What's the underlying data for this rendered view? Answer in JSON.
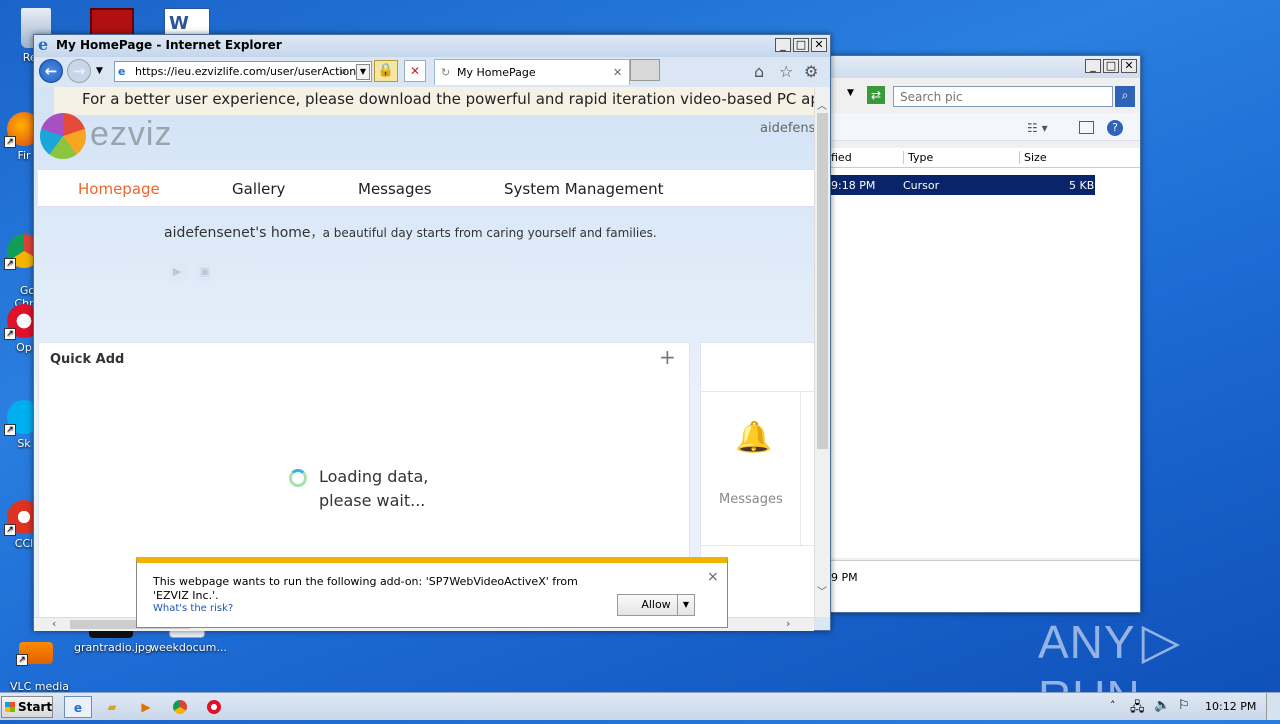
{
  "desktop": {
    "icons": [
      {
        "label": "Recy"
      },
      {
        "label": "Fir"
      },
      {
        "label": "Go\nChr"
      },
      {
        "label": "Op"
      },
      {
        "label": "Sk"
      },
      {
        "label": "CCl"
      },
      {
        "label": "VLC media\nplayer"
      },
      {
        "label": "grantradio.jpg"
      },
      {
        "label": "weekdocum..."
      }
    ],
    "watermark": "ANY",
    "watermark2": "RUN"
  },
  "explorer": {
    "search_placeholder": "Search pic",
    "columns": [
      "fied",
      "Type",
      "Size"
    ],
    "row": {
      "modified": "9:18 PM",
      "type": "Cursor",
      "size": "5 KB"
    },
    "footer": "9 PM"
  },
  "ie": {
    "title": "My HomePage - Internet Explorer",
    "address": "https://ieu.ezvizlife.com/user/userAction!",
    "tab_title": "My HomePage",
    "banner": "For a better user experience, please download the powerful and rapid iteration video-based PC application –",
    "logo": "ezviz",
    "username": "aidefens",
    "menu": [
      "Homepage",
      "Gallery",
      "Messages",
      "System Management"
    ],
    "greeting_name": "aidefensenet's home",
    "greeting_tail": "，a beautiful day starts from caring yourself and families.",
    "quick_add": {
      "title": "Quick Add",
      "plus": "+"
    },
    "loading": {
      "line1": "Loading data,",
      "line2": "please wait..."
    },
    "messages_label": "Messages",
    "notification": {
      "text1": "This webpage wants to run the following add-on: 'SP7WebVideoActiveX' from",
      "text2": "'EZVIZ Inc.'.",
      "risk_link": "What's the risk?",
      "allow": "Allow",
      "close": "×"
    }
  },
  "taskbar": {
    "start": "Start",
    "clock": "10:12 PM"
  }
}
